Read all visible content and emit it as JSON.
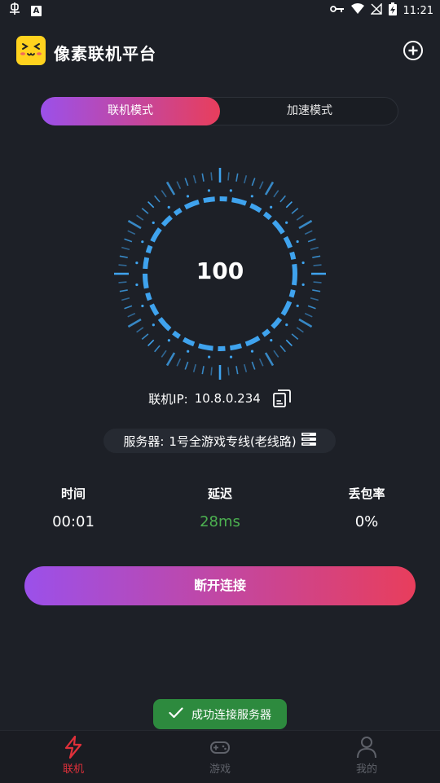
{
  "status_bar": {
    "left_icons": [
      "bug-notification-icon",
      "a-box-notification-icon"
    ],
    "right_icons": [
      "key-icon",
      "wifi-icon",
      "no-signal-icon",
      "battery-charging-icon"
    ],
    "time": "11:21"
  },
  "header": {
    "title": "像素联机平台",
    "logo_icon": "cat-face-logo-icon",
    "action_icon": "add-circle-icon"
  },
  "mode_toggle": {
    "tabs": [
      {
        "label": "联机模式",
        "active": true
      },
      {
        "label": "加速模式",
        "active": false
      }
    ]
  },
  "gauge": {
    "value": "100",
    "accent": "#3fa3ee"
  },
  "connection": {
    "ip_label": "联机IP:",
    "ip_value": "10.8.0.234",
    "copy_icon": "copy-icon",
    "server_label": "服务器:",
    "server_value": "1号全游戏专线(老线路)",
    "server_icon": "server-list-icon"
  },
  "stats": {
    "time": {
      "label": "时间",
      "value": "00:01"
    },
    "latency": {
      "label": "延迟",
      "value": "28ms",
      "color": "#4cb050"
    },
    "loss": {
      "label": "丢包率",
      "value": "0%"
    }
  },
  "actions": {
    "disconnect_label": "断开连接"
  },
  "toast": {
    "text": "成功连接服务器",
    "icon": "check-icon"
  },
  "bottom_nav": {
    "items": [
      {
        "label": "联机",
        "icon": "lightning-icon",
        "active": true
      },
      {
        "label": "游戏",
        "icon": "gamepad-icon",
        "active": false
      },
      {
        "label": "我的",
        "icon": "user-icon",
        "active": false
      }
    ]
  },
  "colors": {
    "background": "#1d2027",
    "gradient_start": "#9b50ea",
    "gradient_end": "#e83e5c",
    "active_nav": "#e0303a",
    "toast_bg": "#2d8a3e"
  }
}
